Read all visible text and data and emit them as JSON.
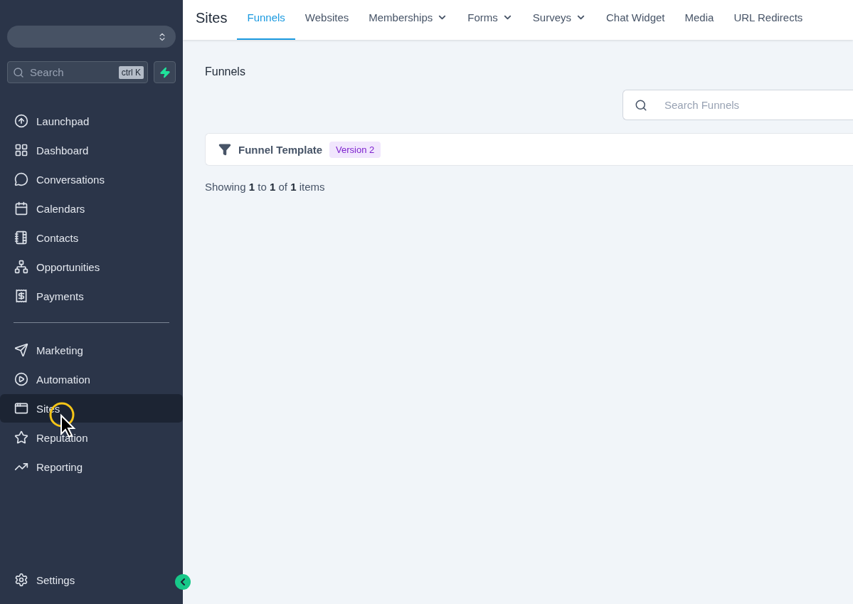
{
  "sidebar": {
    "search": {
      "placeholder": "Search",
      "shortcut": "ctrl K"
    },
    "nav_primary": [
      {
        "label": "Launchpad",
        "selected": false
      },
      {
        "label": "Dashboard",
        "selected": false
      },
      {
        "label": "Conversations",
        "selected": false
      },
      {
        "label": "Calendars",
        "selected": false
      },
      {
        "label": "Contacts",
        "selected": false
      },
      {
        "label": "Opportunities",
        "selected": false
      },
      {
        "label": "Payments",
        "selected": false
      }
    ],
    "nav_secondary": [
      {
        "label": "Marketing",
        "selected": false
      },
      {
        "label": "Automation",
        "selected": false
      },
      {
        "label": "Sites",
        "selected": true
      },
      {
        "label": "Reputation",
        "selected": false
      },
      {
        "label": "Reporting",
        "selected": false
      }
    ],
    "settings": {
      "label": "Settings"
    }
  },
  "topbar": {
    "title": "Sites",
    "tabs": [
      {
        "label": "Funnels",
        "selected": true,
        "has_menu": false
      },
      {
        "label": "Websites",
        "selected": false,
        "has_menu": false
      },
      {
        "label": "Memberships",
        "selected": false,
        "has_menu": true
      },
      {
        "label": "Forms",
        "selected": false,
        "has_menu": true
      },
      {
        "label": "Surveys",
        "selected": false,
        "has_menu": true
      },
      {
        "label": "Chat Widget",
        "selected": false,
        "has_menu": false
      },
      {
        "label": "Media",
        "selected": false,
        "has_menu": false
      },
      {
        "label": "URL Redirects",
        "selected": false,
        "has_menu": false
      }
    ]
  },
  "content": {
    "heading": "Funnels",
    "search": {
      "placeholder": "Search Funnels"
    },
    "funnels": [
      {
        "name": "Funnel Template",
        "badge": "Version 2"
      }
    ],
    "pagination": "Showing **1** to **1** of **1** items"
  }
}
